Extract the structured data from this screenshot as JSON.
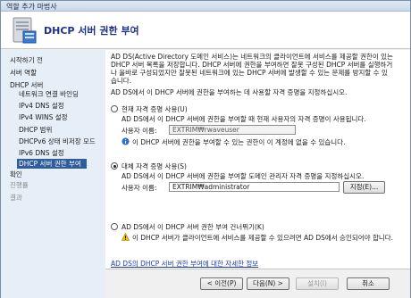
{
  "window": {
    "title": "역할 추가 마법사"
  },
  "header": {
    "title": "DHCP 서버 권한 부여"
  },
  "sidebar": {
    "items": [
      {
        "label": "시작하기 전"
      },
      {
        "label": "서버 역할"
      },
      {
        "label": "DHCP 서버"
      },
      {
        "label": "네트워크 연결 바인딩"
      },
      {
        "label": "IPv4 DNS 설정"
      },
      {
        "label": "IPv4 WINS 설정"
      },
      {
        "label": "DHCP 범위"
      },
      {
        "label": "DHCPv6 상태 비저장 모드"
      },
      {
        "label": "IPv6 DNS 설정"
      },
      {
        "label": "DHCP 서버 권한 부여"
      },
      {
        "label": "확인"
      },
      {
        "label": "진행률"
      },
      {
        "label": "결과"
      }
    ]
  },
  "main": {
    "intro_lines": [
      "AD DS(Active Directory 도메인 서비스)는 네트워크의 클라이언트에 서비스를 제공할 권한이 있는",
      "DHCP 서버 목록을 저장합니다. DHCP 서버에 권한을 부여하면 잘못 구성된 DHCP 서버를 실행하거",
      "나 올바로 구성되었지만 잘못된 네트워크에 있는 DHCP 서버에 발생할 수 있는 문제를 방지할 수 있",
      "습니다."
    ],
    "instruction": "AD DS에서 이 DHCP 서버에 권한을 부여하는 데 사용할 자격 증명을 지정하십시오.",
    "option_current": {
      "label": "현재 자격 증명 사용(U)",
      "desc": "AD DS에서 이 DHCP 서버에 권한을 부여할 때 현재 사용자의 자격 증명이 사용됩니다.",
      "username_label": "사용자 이름:",
      "username_value": "EXTRIM₩rwaveuser",
      "info_text": "이 DHCP 서버에 권한을 부여할 수 있는 권한이 이 계정에 없을 수 있습니다."
    },
    "option_alternate": {
      "label": "대체 자격 증명 사용(S)",
      "desc": "AD DS에서 이 DHCP 서버에 권한을 부여할 도메인 관리자 자격 증명을 지정하십시오.",
      "username_label": "사용자 이름:",
      "username_value": "EXTRIM₩administrator",
      "specify_button": "지정(E)..."
    },
    "option_skip": {
      "label": "AD DS에서 이 DHCP 서버 권한 부여 건너뛰기(K)",
      "warning_text": "이 DHCP 서버가 클라이언트에 서비스를 제공할 수 있으려면 AD DS에서 승인되어야 합니다."
    },
    "more_info_link": "AD DS의 DHCP 서버 권한 부여에 대한 자세한 정보"
  },
  "footer": {
    "prev": "< 이전(P)",
    "next": "다음(N) >",
    "install": "설치(I)",
    "cancel": "취소"
  },
  "colors": {
    "accent": "#2f5d9b",
    "title": "#1e3287",
    "link": "#1f3ca8"
  }
}
